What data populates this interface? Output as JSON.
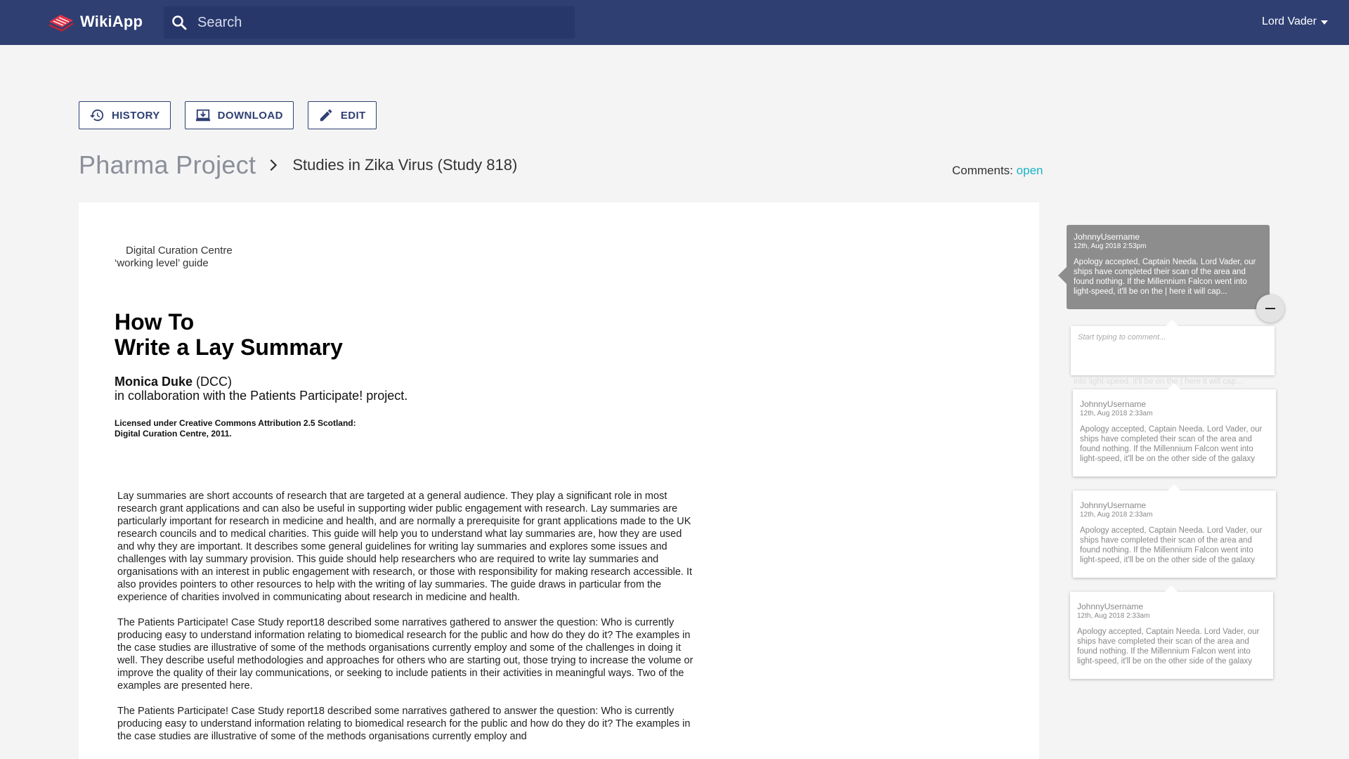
{
  "header": {
    "app_name": "WikiApp",
    "search_placeholder": "Search",
    "user_name": "Lord Vader"
  },
  "toolbar": {
    "history_label": "HISTORY",
    "download_label": "DOWNLOAD",
    "edit_label": "EDIT"
  },
  "breadcrumb": {
    "root": "Pharma Project",
    "current": "Studies in Zika Virus (Study 818)"
  },
  "comments_status": {
    "label": "Comments:",
    "value": "open"
  },
  "document": {
    "org_line1": "Digital Curation Centre",
    "org_line2": "‘working level’ guide",
    "title_line1": "How To",
    "title_line2": "Write a Lay Summary",
    "author_name": "Monica Duke",
    "author_affil": " (DCC)",
    "collab": "in collaboration with the Patients Participate! project.",
    "license_line1": "Licensed under Creative Commons Attribution 2.5 Scotland:",
    "license_line2": "Digital Curation Centre, 2011.",
    "paragraphs": [
      "Lay summaries are short accounts of research that are targeted at a general audience. They play a significant role in most research grant applications and can also be useful in supporting wider public engagement with research. Lay summaries are particularly important for research in medicine and health, and are normally a prerequisite for grant applications made to the UK research councils and to medical charities. This guide will help you to understand what lay summaries are, how they are used and why they are important. It describes some general guidelines for writing lay summaries and explores some issues and challenges with lay summary provision. This guide should help researchers who are required to write lay summaries and organisations with an interest in public engagement with research, or those with responsibility for making research accessible. It also provides pointers to other resources to help with the writing of lay summaries. The guide draws in particular from the experience of charities involved in communicating about research in medicine and health.",
      "The Patients Participate! Case Study report18 described some narratives gathered to answer the question: Who is currently producing easy to understand information relating to biomedical research for the public and how do they do it? The examples in the case studies are illustrative of some of the methods organisations currently employ and some of the challenges in doing it well. They describe useful methodologies and approaches for others who are starting out, those trying to increase the volume or improve the quality of their lay communications, or seeking to include patients in their activities in meaningful ways. Two of the examples are presented here.",
      "The Patients Participate! Case Study report18 described some narratives gathered to answer the question: Who is currently producing easy to understand information relating to biomedical research for the public and how do they do it? The examples in the case studies are illustrative of some of the methods organisations currently employ and"
    ]
  },
  "comments": {
    "active": {
      "user": "JohnnyUsername",
      "date": "12th, Aug 2018 2:53pm",
      "body": "Apology accepted, Captain Needa. Lord Vader, our ships have completed their scan of the area and found nothing. If the Millennium Falcon went into light-speed, it'll be on the | here it will cap..."
    },
    "new_placeholder": "Start typing to comment...",
    "ghost_text": "into light-speed, it'll be on the | here it will cap...",
    "list": [
      {
        "user": "JohnnyUsername",
        "date": "12th, Aug 2018 2:33am",
        "body": "Apology accepted, Captain Needa. Lord Vader, our ships have completed their scan of the area and found nothing. If the Millennium Falcon went into light-speed, it'll be on the other side of the galaxy"
      },
      {
        "user": "JohnnyUsername",
        "date": "12th, Aug 2018 2:33am",
        "body": "Apology accepted, Captain Needa. Lord Vader, our ships have completed their scan of the area and found nothing. If the Millennium Falcon went into light-speed, it'll be on the other side of the galaxy"
      },
      {
        "user": "JohnnyUsername",
        "date": "12th, Aug 2018 2:33am",
        "body": "Apology accepted, Captain Needa. Lord Vader, our ships have completed their scan of the area and found nothing. If the Millennium Falcon went into light-speed, it'll be on the other side of the galaxy"
      }
    ]
  },
  "colors": {
    "header_bg": "#2f3f72",
    "search_bg": "#28376a",
    "accent_open": "#1ab3c5",
    "logo_red": "#e0334a"
  },
  "icons": {
    "logo": "wikiapp-logo-icon",
    "search": "search-icon",
    "history": "history-icon",
    "download": "download-icon",
    "edit": "pencil-icon",
    "breadcrumb_sep": "chevron-right-icon",
    "user_menu": "caret-down-icon",
    "minimize": "minus-icon"
  }
}
